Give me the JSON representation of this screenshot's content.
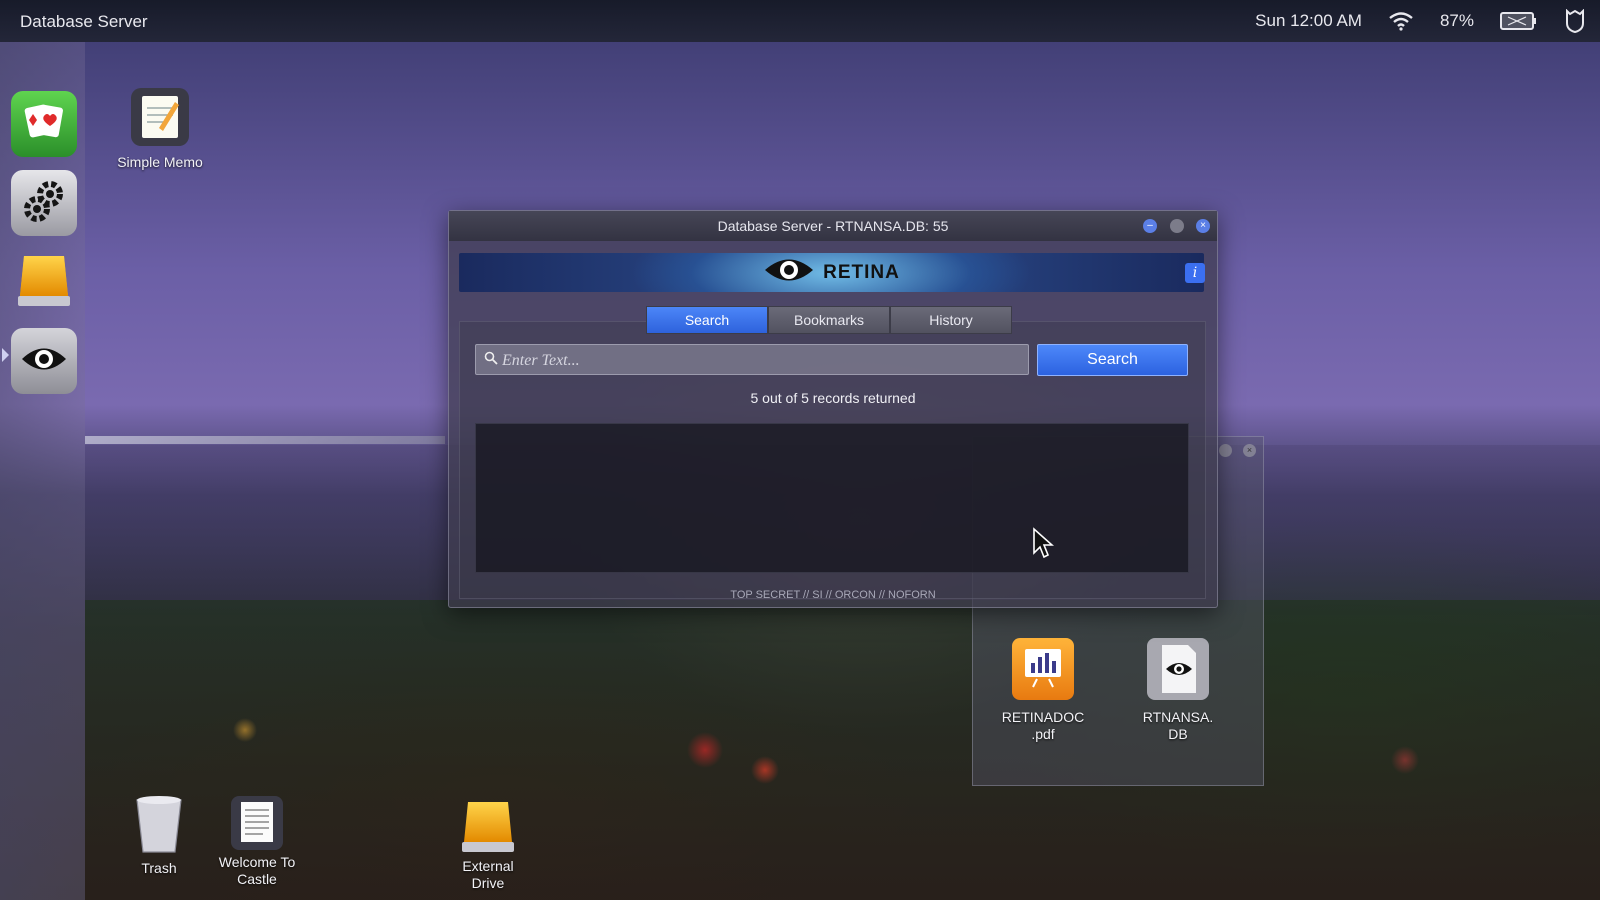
{
  "menubar": {
    "app_title": "Database Server",
    "clock": "Sun 12:00 AM",
    "battery": "87%"
  },
  "desktop": {
    "simple_memo": "Simple Memo",
    "trash": "Trash",
    "welcome": "Welcome To Castle",
    "external_drive": "External Drive"
  },
  "window": {
    "title": "Database Server - RTNANSA.DB: 55",
    "brand": "RETINA",
    "info": "i",
    "tabs": [
      "Search",
      "Bookmarks",
      "History"
    ],
    "active_tab": "Search",
    "search_placeholder": "Enter Text...",
    "search_button": "Search",
    "records": "5 out of 5 records returned",
    "classification": "TOP SECRET // SI // ORCON // NOFORN"
  },
  "files": {
    "retinadoc": "RETINADOC .pdf",
    "rtnansa": "RTNANSA. DB"
  },
  "colors": {
    "accent": "#3b6ff0",
    "menubar": "#1a1e2c"
  },
  "icons": [
    "playing-cards-icon",
    "gear-icon",
    "drive-icon",
    "eye-icon",
    "memo-icon",
    "trash-icon",
    "document-icon",
    "external-drive-icon",
    "wifi-icon",
    "battery-icon",
    "shield-icon",
    "chart-document-icon",
    "eye-database-icon",
    "search-icon",
    "info-icon",
    "cursor-icon"
  ]
}
